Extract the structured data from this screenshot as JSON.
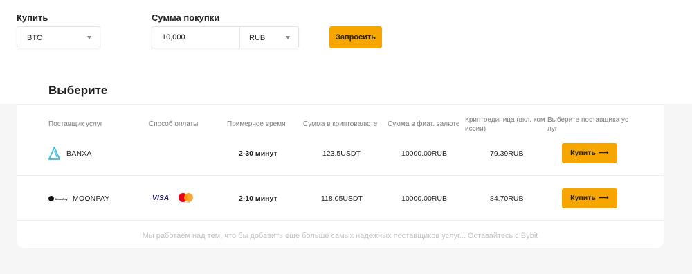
{
  "form": {
    "buy_label": "Купить",
    "amount_label": "Сумма покупки",
    "crypto_select": "BTC",
    "amount_value": "10,000",
    "fiat_select": "RUB",
    "request_button": "Запросить"
  },
  "card": {
    "title": "Выберите",
    "headers": {
      "provider": "Поставщик услуг",
      "payment": "Способ оплаты",
      "time": "Примерное время",
      "crypto_sum": "Сумма в криптовалюте",
      "fiat_sum": "Сумма в фиат. валюте",
      "unit_line1": "Криптоединица (вкл. ком",
      "unit_line2": "иссии)",
      "choose_line1": "Выберите поставщика ус",
      "choose_line2": "луг"
    },
    "rows": [
      {
        "provider": "BANXA",
        "time": "2-30 минут",
        "crypto_sum": "123.5USDT",
        "fiat_sum": "10000.00RUB",
        "unit_price": "79.39RUB",
        "button": "Купить"
      },
      {
        "provider": "MOONPAY",
        "logo_text": "MoonPay",
        "visa": "VISA",
        "mastercard_text": "mastercard",
        "time": "2-10 минут",
        "crypto_sum": "118.05USDT",
        "fiat_sum": "10000.00RUB",
        "unit_price": "84.70RUB",
        "button": "Купить"
      }
    ],
    "footer": "Мы работаем над тем, что бы добавить еще больше самых надежных поставщиков услуг... Оставайтесь с Bybit"
  },
  "colors": {
    "accent": "#f7a600",
    "banxa_logo": "#4ec3e0"
  },
  "icons": {
    "caret": "chevron-down-icon",
    "arrow": "arrow-right-icon",
    "banxa": "banxa-logo",
    "moonpay": "moonpay-logo",
    "visa": "visa-logo",
    "mastercard": "mastercard-logo"
  }
}
